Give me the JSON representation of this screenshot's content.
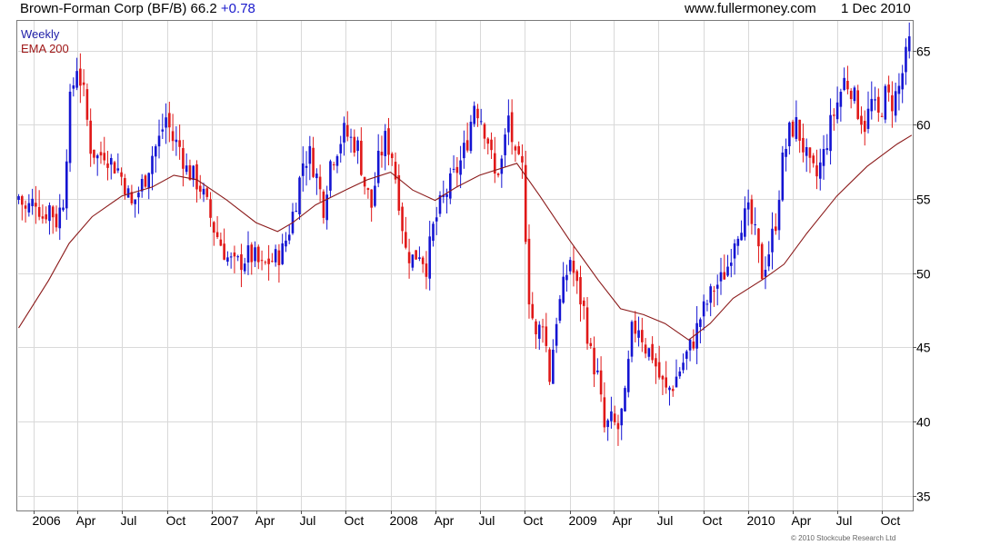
{
  "header": {
    "company": "Brown-Forman Corp (BF/B)",
    "price": "66.2",
    "change": "+0.78",
    "site": "www.fullermoney.com",
    "date": "1 Dec 2010"
  },
  "footer": {
    "copyright": "© 2010 Stockcube Research Ltd"
  },
  "chart_data": {
    "type": "candlestick",
    "title": "Brown-Forman Corp (BF/B) 66.2 +0.78",
    "legend": [
      {
        "name": "Weekly",
        "color": "#1f1fa8"
      },
      {
        "name": "EMA 200",
        "color": "#a01818"
      }
    ],
    "colors": {
      "up": "#1414d2",
      "down": "#e01818",
      "ema": "#8b1a1a",
      "grid": "#d9d9d9"
    },
    "y_axis": {
      "side": "right",
      "range": [
        34,
        67
      ],
      "ticks": [
        35,
        40,
        45,
        50,
        55,
        60,
        65
      ]
    },
    "x_axis": {
      "range": [
        "2005-12-01",
        "2010-12-03"
      ],
      "ticks": [
        {
          "label": "2006",
          "date": "2006-01-01"
        },
        {
          "label": "Apr",
          "date": "2006-04-01"
        },
        {
          "label": "Jul",
          "date": "2006-07-01"
        },
        {
          "label": "Oct",
          "date": "2006-10-01"
        },
        {
          "label": "2007",
          "date": "2007-01-01"
        },
        {
          "label": "Apr",
          "date": "2007-04-01"
        },
        {
          "label": "Jul",
          "date": "2007-07-01"
        },
        {
          "label": "Oct",
          "date": "2007-10-01"
        },
        {
          "label": "2008",
          "date": "2008-01-01"
        },
        {
          "label": "Apr",
          "date": "2008-04-01"
        },
        {
          "label": "Jul",
          "date": "2008-07-01"
        },
        {
          "label": "Oct",
          "date": "2008-10-01"
        },
        {
          "label": "2009",
          "date": "2009-01-01"
        },
        {
          "label": "Apr",
          "date": "2009-04-01"
        },
        {
          "label": "Jul",
          "date": "2009-07-01"
        },
        {
          "label": "Oct",
          "date": "2009-10-01"
        },
        {
          "label": "2010",
          "date": "2010-01-01"
        },
        {
          "label": "Apr",
          "date": "2010-04-01"
        },
        {
          "label": "Jul",
          "date": "2010-07-01"
        },
        {
          "label": "Oct",
          "date": "2010-10-01"
        }
      ]
    },
    "close_anchors": [
      [
        "2005-12-02",
        55.2
      ],
      [
        "2005-12-16",
        54.2
      ],
      [
        "2006-01-06",
        55.0
      ],
      [
        "2006-01-20",
        53.8
      ],
      [
        "2006-02-03",
        54.5
      ],
      [
        "2006-02-17",
        53.5
      ],
      [
        "2006-03-03",
        55.0
      ],
      [
        "2006-03-17",
        61.5
      ],
      [
        "2006-03-31",
        64.0
      ],
      [
        "2006-04-14",
        62.0
      ],
      [
        "2006-04-28",
        58.5
      ],
      [
        "2006-05-12",
        57.8
      ],
      [
        "2006-05-26",
        58.2
      ],
      [
        "2006-06-09",
        57.5
      ],
      [
        "2006-06-23",
        57.0
      ],
      [
        "2006-07-07",
        56.0
      ],
      [
        "2006-07-21",
        54.5
      ],
      [
        "2006-08-04",
        55.5
      ],
      [
        "2006-08-18",
        56.5
      ],
      [
        "2006-09-01",
        58.0
      ],
      [
        "2006-09-15",
        59.0
      ],
      [
        "2006-09-29",
        60.5
      ],
      [
        "2006-10-13",
        59.0
      ],
      [
        "2006-10-27",
        58.5
      ],
      [
        "2006-11-10",
        57.0
      ],
      [
        "2006-11-24",
        56.5
      ],
      [
        "2006-12-08",
        55.8
      ],
      [
        "2006-12-22",
        54.5
      ],
      [
        "2007-01-05",
        53.0
      ],
      [
        "2007-01-19",
        52.0
      ],
      [
        "2007-02-02",
        51.0
      ],
      [
        "2007-02-16",
        50.5
      ],
      [
        "2007-03-02",
        50.8
      ],
      [
        "2007-03-16",
        51.2
      ],
      [
        "2007-03-30",
        51.0
      ],
      [
        "2007-04-13",
        50.3
      ],
      [
        "2007-04-27",
        50.8
      ],
      [
        "2007-05-11",
        51.0
      ],
      [
        "2007-05-25",
        51.5
      ],
      [
        "2007-06-08",
        53.0
      ],
      [
        "2007-06-22",
        55.0
      ],
      [
        "2007-07-06",
        57.5
      ],
      [
        "2007-07-20",
        58.0
      ],
      [
        "2007-08-03",
        56.5
      ],
      [
        "2007-08-17",
        54.5
      ],
      [
        "2007-08-31",
        57.5
      ],
      [
        "2007-09-14",
        58.5
      ],
      [
        "2007-09-28",
        59.5
      ],
      [
        "2007-10-12",
        59.0
      ],
      [
        "2007-10-26",
        58.5
      ],
      [
        "2007-11-09",
        56.0
      ],
      [
        "2007-11-23",
        54.5
      ],
      [
        "2007-12-07",
        57.5
      ],
      [
        "2007-12-21",
        59.0
      ],
      [
        "2008-01-04",
        58.0
      ],
      [
        "2008-01-18",
        55.0
      ],
      [
        "2008-02-01",
        51.5
      ],
      [
        "2008-02-15",
        51.0
      ],
      [
        "2008-02-29",
        51.5
      ],
      [
        "2008-03-14",
        50.5
      ],
      [
        "2008-03-28",
        53.0
      ],
      [
        "2008-04-11",
        54.5
      ],
      [
        "2008-04-25",
        55.5
      ],
      [
        "2008-05-09",
        56.5
      ],
      [
        "2008-05-23",
        57.5
      ],
      [
        "2008-06-06",
        59.0
      ],
      [
        "2008-06-20",
        61.5
      ],
      [
        "2008-07-04",
        60.5
      ],
      [
        "2008-07-18",
        59.0
      ],
      [
        "2008-08-01",
        56.5
      ],
      [
        "2008-08-15",
        57.5
      ],
      [
        "2008-08-29",
        60.5
      ],
      [
        "2008-09-12",
        57.5
      ],
      [
        "2008-09-26",
        57.0
      ],
      [
        "2008-10-10",
        48.5
      ],
      [
        "2008-10-24",
        45.5
      ],
      [
        "2008-11-07",
        47.0
      ],
      [
        "2008-11-21",
        43.0
      ],
      [
        "2008-12-05",
        47.0
      ],
      [
        "2008-12-19",
        49.0
      ],
      [
        "2009-01-02",
        51.0
      ],
      [
        "2009-01-16",
        49.0
      ],
      [
        "2009-01-30",
        47.5
      ],
      [
        "2009-02-13",
        44.5
      ],
      [
        "2009-02-27",
        43.0
      ],
      [
        "2009-03-13",
        39.5
      ],
      [
        "2009-03-27",
        40.0
      ],
      [
        "2009-04-10",
        39.5
      ],
      [
        "2009-04-24",
        41.5
      ],
      [
        "2009-05-08",
        46.0
      ],
      [
        "2009-05-22",
        46.5
      ],
      [
        "2009-06-05",
        45.0
      ],
      [
        "2009-06-19",
        44.5
      ],
      [
        "2009-07-03",
        43.0
      ],
      [
        "2009-07-17",
        42.0
      ],
      [
        "2009-07-31",
        42.5
      ],
      [
        "2009-08-14",
        43.5
      ],
      [
        "2009-08-28",
        44.5
      ],
      [
        "2009-09-11",
        45.5
      ],
      [
        "2009-09-25",
        47.0
      ],
      [
        "2009-10-09",
        48.0
      ],
      [
        "2009-10-23",
        49.0
      ],
      [
        "2009-11-06",
        49.5
      ],
      [
        "2009-11-20",
        50.5
      ],
      [
        "2009-12-04",
        52.5
      ],
      [
        "2009-12-18",
        53.5
      ],
      [
        "2010-01-01",
        54.0
      ],
      [
        "2010-01-15",
        52.5
      ],
      [
        "2010-01-29",
        50.0
      ],
      [
        "2010-02-12",
        51.5
      ],
      [
        "2010-02-26",
        53.5
      ],
      [
        "2010-03-12",
        57.5
      ],
      [
        "2010-03-26",
        59.5
      ],
      [
        "2010-04-09",
        60.0
      ],
      [
        "2010-04-23",
        58.5
      ],
      [
        "2010-05-07",
        57.0
      ],
      [
        "2010-05-21",
        56.5
      ],
      [
        "2010-06-04",
        58.0
      ],
      [
        "2010-06-18",
        60.0
      ],
      [
        "2010-07-02",
        61.5
      ],
      [
        "2010-07-16",
        63.0
      ],
      [
        "2010-07-30",
        62.5
      ],
      [
        "2010-08-13",
        61.0
      ],
      [
        "2010-08-27",
        60.0
      ],
      [
        "2010-09-10",
        61.5
      ],
      [
        "2010-09-24",
        60.5
      ],
      [
        "2010-10-08",
        62.0
      ],
      [
        "2010-10-22",
        61.5
      ],
      [
        "2010-11-05",
        62.5
      ],
      [
        "2010-11-19",
        64.5
      ],
      [
        "2010-12-01",
        66.2
      ]
    ],
    "ema_200": [
      [
        "2005-12-02",
        46.3
      ],
      [
        "2006-02-01",
        49.5
      ],
      [
        "2006-03-15",
        52.0
      ],
      [
        "2006-05-01",
        53.8
      ],
      [
        "2006-07-01",
        55.2
      ],
      [
        "2006-09-01",
        55.8
      ],
      [
        "2006-10-15",
        56.6
      ],
      [
        "2006-12-01",
        56.3
      ],
      [
        "2007-02-01",
        54.9
      ],
      [
        "2007-04-01",
        53.4
      ],
      [
        "2007-05-15",
        52.8
      ],
      [
        "2007-06-15",
        53.4
      ],
      [
        "2007-08-01",
        54.6
      ],
      [
        "2007-10-01",
        55.6
      ],
      [
        "2007-11-15",
        56.3
      ],
      [
        "2008-01-01",
        56.8
      ],
      [
        "2008-02-15",
        55.6
      ],
      [
        "2008-04-01",
        54.9
      ],
      [
        "2008-05-15",
        55.8
      ],
      [
        "2008-07-01",
        56.6
      ],
      [
        "2008-09-15",
        57.4
      ],
      [
        "2008-11-01",
        55.2
      ],
      [
        "2009-01-01",
        52.2
      ],
      [
        "2009-03-01",
        49.5
      ],
      [
        "2009-04-15",
        47.6
      ],
      [
        "2009-06-01",
        47.2
      ],
      [
        "2009-07-15",
        46.6
      ],
      [
        "2009-09-01",
        45.5
      ],
      [
        "2009-10-15",
        46.6
      ],
      [
        "2009-12-01",
        48.3
      ],
      [
        "2010-02-01",
        49.6
      ],
      [
        "2010-03-15",
        50.6
      ],
      [
        "2010-05-01",
        52.7
      ],
      [
        "2010-07-01",
        55.2
      ],
      [
        "2010-09-01",
        57.2
      ],
      [
        "2010-11-01",
        58.7
      ],
      [
        "2010-12-01",
        59.3
      ]
    ]
  }
}
